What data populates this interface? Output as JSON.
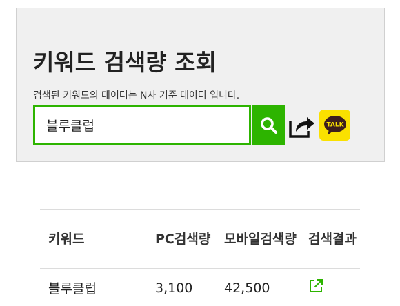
{
  "search": {
    "title": "키워드 검색량 조회",
    "description": "검색된 키워드의 데이터는 N사 기준 데이터 입니다.",
    "input_value": "블루클럽"
  },
  "table": {
    "headers": {
      "keyword": "키워드",
      "pc": "PC검색량",
      "mobile": "모바일검색량",
      "result": "검색결과"
    },
    "rows": [
      {
        "keyword": "블루클럽",
        "pc": "3,100",
        "mobile": "42,500"
      }
    ]
  },
  "icons": {
    "search": "search-icon",
    "share": "share-icon",
    "kakao": "kakaotalk-icon",
    "external": "external-link-icon"
  },
  "kakao_label": "TALK",
  "colors": {
    "accent": "#2db400",
    "kakao": "#fae100",
    "card_bg": "#f0f0f0"
  }
}
